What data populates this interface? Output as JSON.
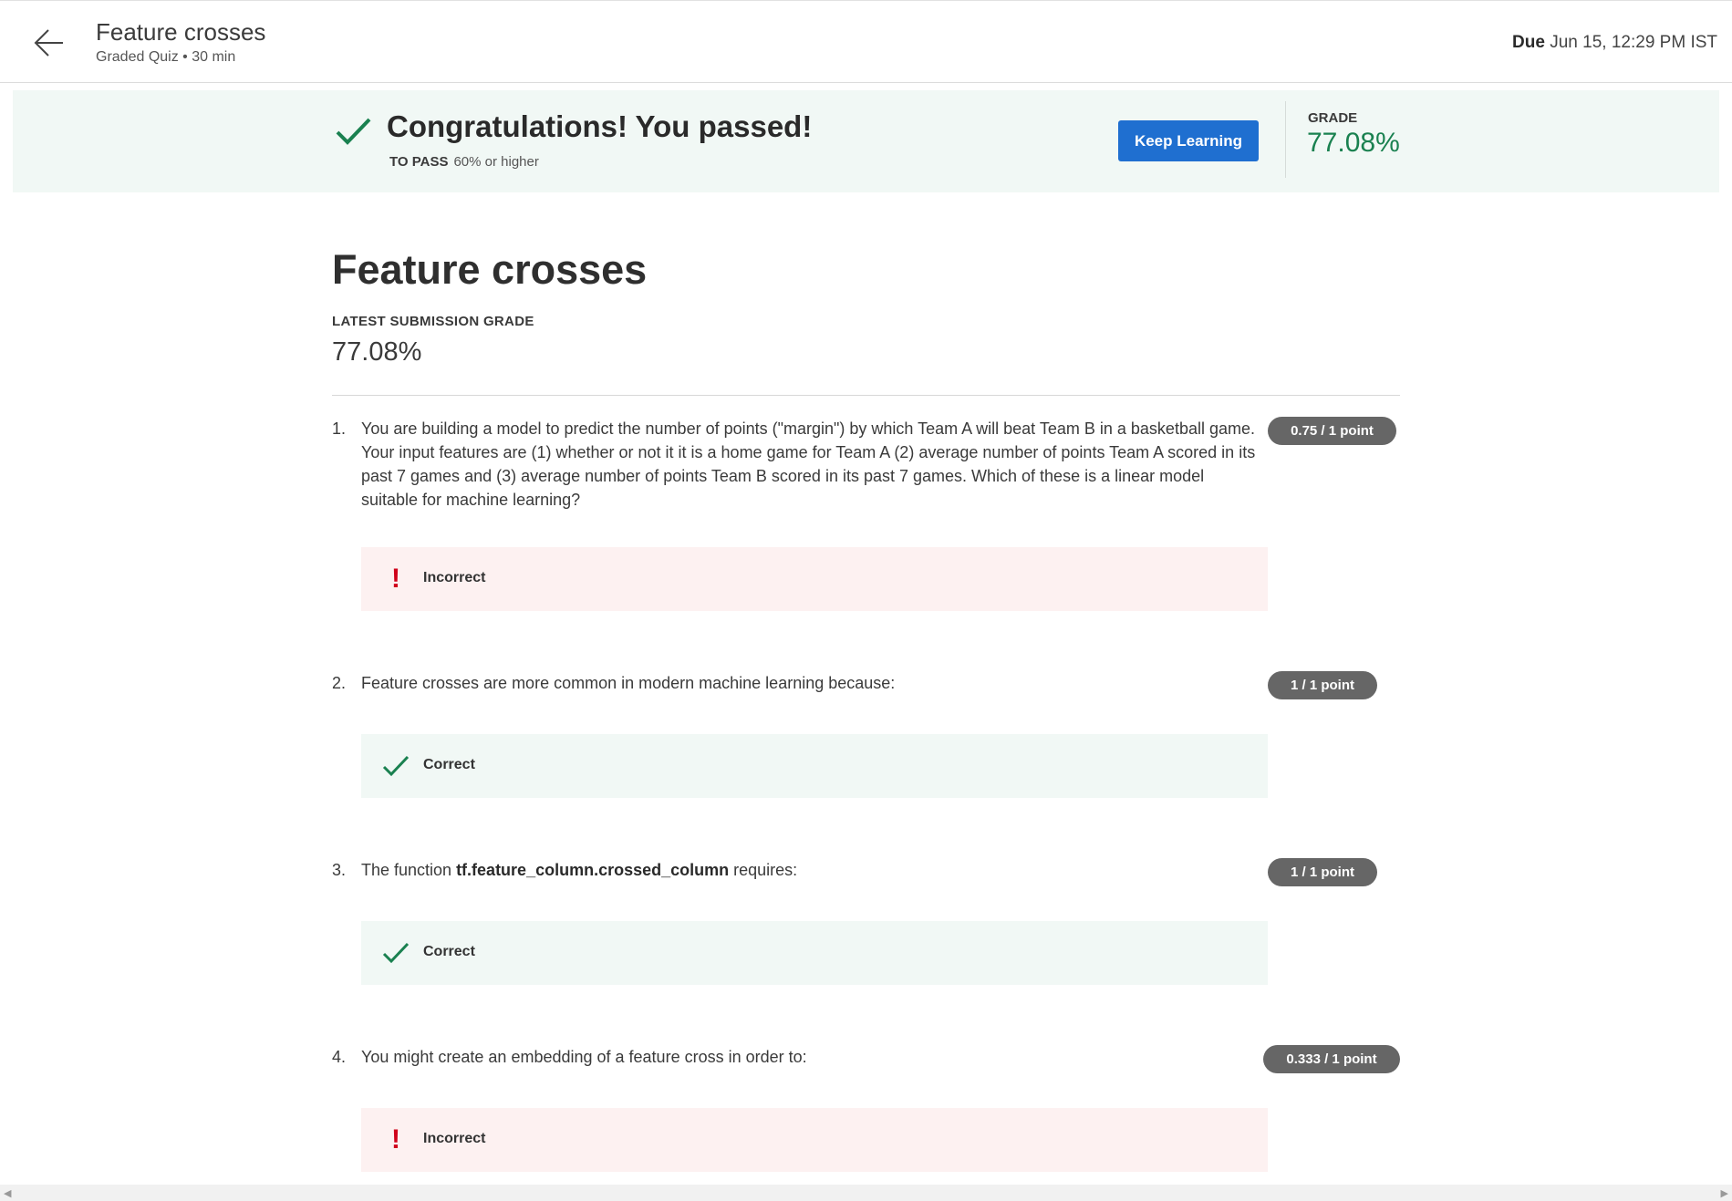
{
  "header": {
    "title": "Feature crosses",
    "subtitle": "Graded Quiz • 30 min",
    "due_label": "Due",
    "due_value": "Jun 15, 12:29 PM IST"
  },
  "banner": {
    "message": "Congratulations! You passed!",
    "to_pass_label": "TO PASS",
    "to_pass_value": "60% or higher",
    "button_label": "Keep Learning",
    "grade_label": "GRADE",
    "grade_value": "77.08%"
  },
  "main": {
    "title": "Feature crosses",
    "latest_grade_label": "LATEST SUBMISSION GRADE",
    "latest_grade_value": "77.08%"
  },
  "questions": [
    {
      "number": "1.",
      "text": "You are building a model to predict the number of points (\"margin\") by which Team A will beat Team B in a basketball game. Your input features are (1) whether or not it it is a home game for Team A (2) average number of points Team A scored in its past 7 games and (3) average number of points Team B scored in its past 7 games. Which of these is a linear model suitable for machine learning?",
      "points": "0.75 / 1 point",
      "result": "Incorrect"
    },
    {
      "number": "2.",
      "text": "Feature crosses are more common in modern machine learning because:",
      "points": "1 / 1 point",
      "result": "Correct"
    },
    {
      "number": "3.",
      "text_before": "The function ",
      "code": "tf.feature_column.crossed_column",
      "text_after": " requires:",
      "points": "1 / 1 point",
      "result": "Correct"
    },
    {
      "number": "4.",
      "text": "You might create an embedding of a feature cross in order to:",
      "points": "0.333 / 1 point",
      "result": "Incorrect"
    }
  ],
  "colors": {
    "primary_button": "#1f6fd0",
    "success_green": "#1a8150",
    "error_red": "#d0021b",
    "points_badge": "#666666"
  }
}
